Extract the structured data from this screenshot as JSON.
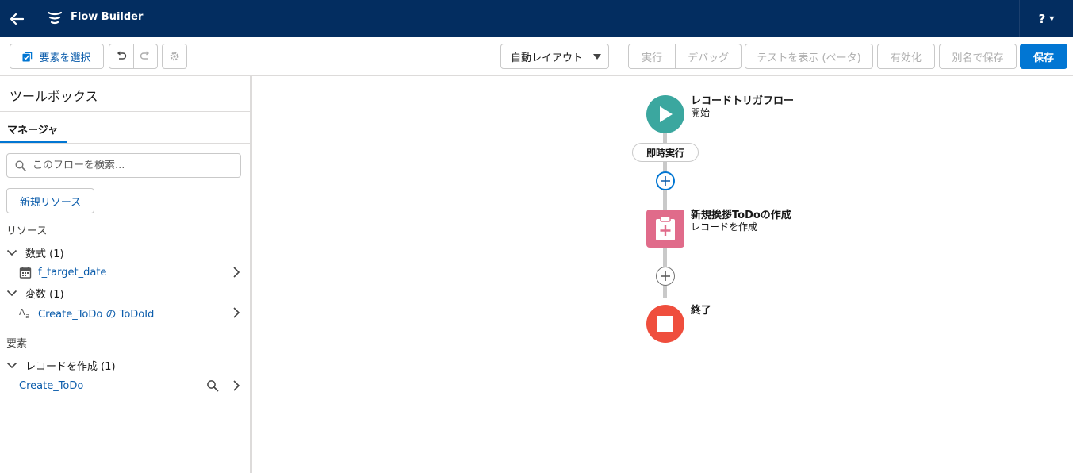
{
  "header": {
    "app_title": "Flow Builder",
    "help_label": "?",
    "back_icon": "arrow-left-icon"
  },
  "toolbar": {
    "select_elements_label": "要素を選択",
    "layout_value": "自動レイアウト",
    "run_label": "実行",
    "debug_label": "デバッグ",
    "test_label": "テストを表示 (ベータ)",
    "activate_label": "有効化",
    "save_as_label": "別名で保存",
    "save_label": "保存"
  },
  "sidebar": {
    "title": "ツールボックス",
    "tab_label": "マネージャ",
    "search_placeholder": "このフローを検索...",
    "new_resource_label": "新規リソース",
    "resources_label": "リソース",
    "formula_group": "数式 (1)",
    "formula_item": "f_target_date",
    "variable_group": "変数 (1)",
    "variable_item": "Create_ToDo の ToDoId",
    "elements_label": "要素",
    "create_record_group": "レコードを作成 (1)",
    "create_record_item": "Create_ToDo"
  },
  "canvas": {
    "start": {
      "title": "レコードトリガフロー",
      "subtitle": "開始",
      "color": "#3ba79f"
    },
    "path_label": "即時実行",
    "create_node": {
      "title": "新規挨拶ToDoの作成",
      "subtitle": "レコードを作成",
      "color": "#e06b8a"
    },
    "end": {
      "title": "終了",
      "color": "#ef4e3d"
    }
  },
  "colors": {
    "header_bg": "#032d60",
    "brand": "#0176d3",
    "link": "#0b5cab"
  }
}
